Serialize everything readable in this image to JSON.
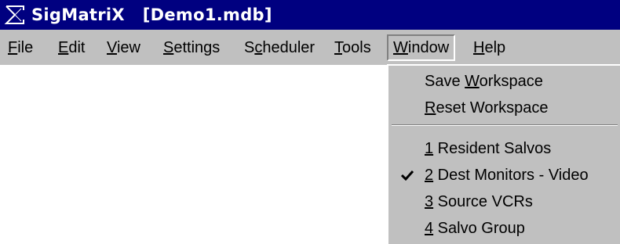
{
  "window": {
    "title": "SigMatriX   [Demo1.mdb]",
    "icon": "sigma-icon"
  },
  "menubar": {
    "items": [
      {
        "pre": "",
        "key": "F",
        "post": "ile"
      },
      {
        "pre": "",
        "key": "E",
        "post": "dit"
      },
      {
        "pre": "",
        "key": "V",
        "post": "iew"
      },
      {
        "pre": "",
        "key": "S",
        "post": "ettings"
      },
      {
        "pre": "S",
        "key": "c",
        "post": "heduler"
      },
      {
        "pre": "",
        "key": "T",
        "post": "ools"
      },
      {
        "pre": "",
        "key": "W",
        "post": "indow"
      },
      {
        "pre": "",
        "key": "H",
        "post": "elp"
      }
    ],
    "open_item": "Window"
  },
  "window_menu": {
    "items": [
      {
        "pre": "Save ",
        "key": "W",
        "post": "orkspace",
        "checked": false
      },
      {
        "pre": "",
        "key": "R",
        "post": "eset Workspace",
        "checked": false
      },
      {
        "pre": "",
        "key": "1",
        "post": " Resident Salvos",
        "checked": false
      },
      {
        "pre": "",
        "key": "2",
        "post": " Dest Monitors - Video",
        "checked": true
      },
      {
        "pre": "",
        "key": "3",
        "post": " Source VCRs",
        "checked": false
      },
      {
        "pre": "",
        "key": "4",
        "post": " Salvo Group",
        "checked": false
      }
    ]
  }
}
